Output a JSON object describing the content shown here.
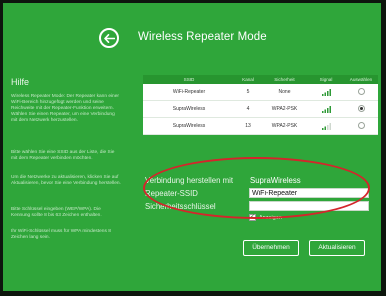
{
  "header": {
    "title": "Wireless Repeater Mode"
  },
  "sidebar": {
    "title": "Hilfe",
    "paragraphs": [
      "Wireless Repeater Mode: Der Repeater kann einer WiFi-Bereich hinzugefügt werden und seine Reichweite mit der Repeater-Funktion erweitern. Wählen Sie einen Repeater, um eine Verbindung mit dem Netzwerk herzustellen.",
      "Bitte wählen Sie eine SSID aus der Liste, die Sie mit dem Repeater verbinden möchten.",
      "Um die Netzwerke zu aktualisieren, klicken Sie auf Aktualisieren, bevor Sie eine Verbindung herstellen.",
      "Bitte Schlüssel eingeben (WEP/WPA). Die Kennung sollte 8 bis 63 Zeichen enthalten.",
      "Ihr WiFi-Schlüssel muss für WPA mindestens 8 Zeichen lang sein."
    ]
  },
  "table": {
    "headers": [
      "SSID",
      "Kanal",
      "Sicherheit",
      "Signal",
      "Auswählen"
    ],
    "rows": [
      {
        "ssid": "WiFi-Repeater",
        "channel": "5",
        "security": "None",
        "signal": 4,
        "selected": false
      },
      {
        "ssid": "SupraWireless",
        "channel": "4",
        "security": "WPA2-PSK",
        "signal": 4,
        "selected": true
      },
      {
        "ssid": "SupraWireless",
        "channel": "13",
        "security": "WPA2-PSK",
        "signal": 2,
        "selected": false
      }
    ]
  },
  "form": {
    "connect_label": "Verbindung herstellen mit",
    "connect_value": "SupraWireless",
    "ssid_label": "Repeater-SSID",
    "ssid_value": "WiFi-Repeater",
    "key_label": "Sicherheitsschlüssel",
    "key_value": "",
    "show_label": "Anzeigen",
    "show_checked": true
  },
  "buttons": {
    "apply": "Übernehmen",
    "refresh": "Aktualisieren"
  },
  "colors": {
    "background": "#2fa63a",
    "highlight": "#d4252b"
  }
}
